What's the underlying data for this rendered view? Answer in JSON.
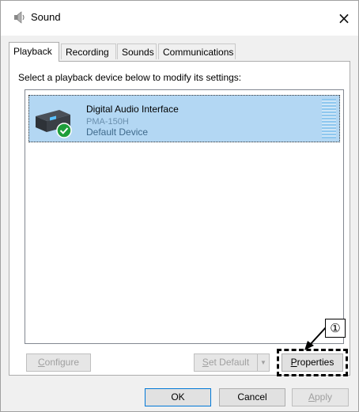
{
  "window": {
    "title": "Sound",
    "close_glyph": "×",
    "icon": "speaker-icon"
  },
  "tabs": [
    {
      "label": "Playback",
      "active": true
    },
    {
      "label": "Recording",
      "active": false
    },
    {
      "label": "Sounds",
      "active": false
    },
    {
      "label": "Communications",
      "active": false
    }
  ],
  "playback": {
    "instruction": "Select a playback device below to modify its settings:",
    "devices": [
      {
        "name": "Digital Audio Interface",
        "model": "PMA-150H",
        "status": "Default Device",
        "selected": true,
        "icon": "audio-device-icon",
        "status_icon": "check-icon"
      }
    ]
  },
  "buttons": {
    "configure": {
      "pre": "",
      "u": "C",
      "post": "onfigure",
      "enabled": false
    },
    "set_default": {
      "pre": "",
      "u": "S",
      "post": "et Default",
      "enabled": false
    },
    "set_default_arrow": "▼",
    "properties": {
      "pre": "",
      "u": "P",
      "post": "roperties",
      "enabled": true
    },
    "ok": "OK",
    "cancel": "Cancel",
    "apply": {
      "pre": "",
      "u": "A",
      "post": "pply",
      "enabled": false
    }
  },
  "annotation": {
    "callout_label": "①"
  },
  "colors": {
    "selection": "#b3d7f3",
    "accent": "#0078d7",
    "check": "#1e9e3a"
  }
}
